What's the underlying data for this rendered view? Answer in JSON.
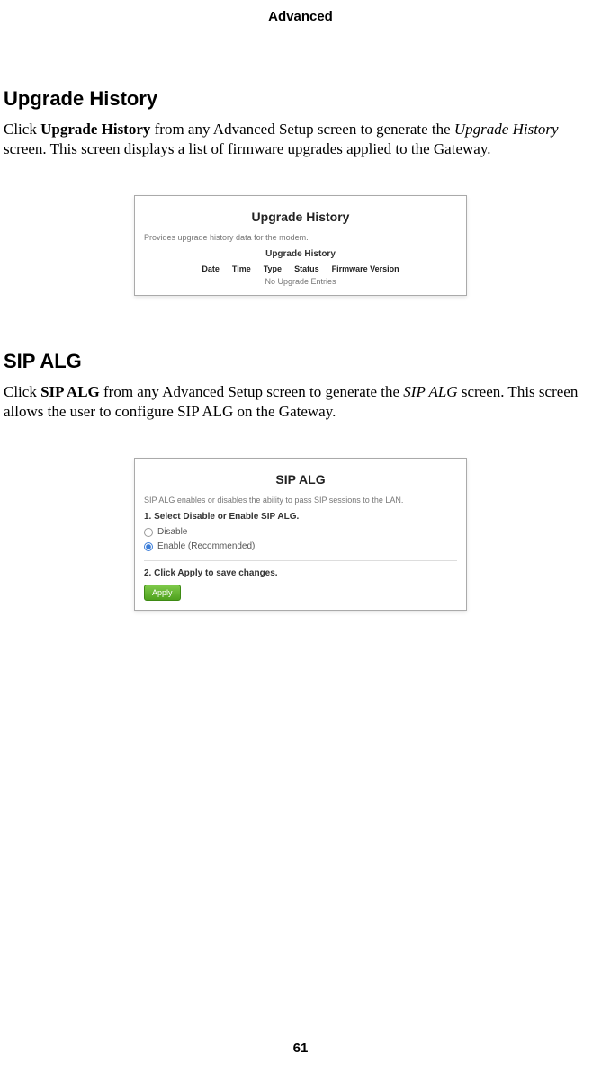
{
  "header": "Advanced",
  "pageNumber": "61",
  "section1": {
    "heading": "Upgrade History",
    "para_prefix": "Click ",
    "para_bold": "Upgrade History",
    "para_mid": " from any Advanced Setup screen to generate the ",
    "para_italic": "Upgrade History",
    "para_suffix": " screen. This screen displays a list of firmware upgrades applied to the Gateway.",
    "panel": {
      "title": "Upgrade History",
      "desc": "Provides upgrade history data for the modem.",
      "subhead": "Upgrade History",
      "cols": {
        "c1": "Date",
        "c2": "Time",
        "c3": "Type",
        "c4": "Status",
        "c5": "Firmware Version"
      },
      "noEntries": "No Upgrade Entries"
    }
  },
  "section2": {
    "heading": "SIP ALG",
    "para_prefix": "Click ",
    "para_bold": "SIP ALG",
    "para_mid": " from any Advanced Setup screen to generate the ",
    "para_italic": "SIP ALG",
    "para_suffix": " screen. This screen allows the user to configure SIP ALG on the Gateway.",
    "panel": {
      "title": "SIP ALG",
      "desc": "SIP ALG enables or disables the ability to pass SIP sessions to the LAN.",
      "step1": "1. Select Disable or Enable SIP ALG.",
      "optDisable": "Disable",
      "optEnable": "Enable (Recommended)",
      "step2": "2. Click Apply to save changes.",
      "applyLabel": "Apply"
    }
  }
}
